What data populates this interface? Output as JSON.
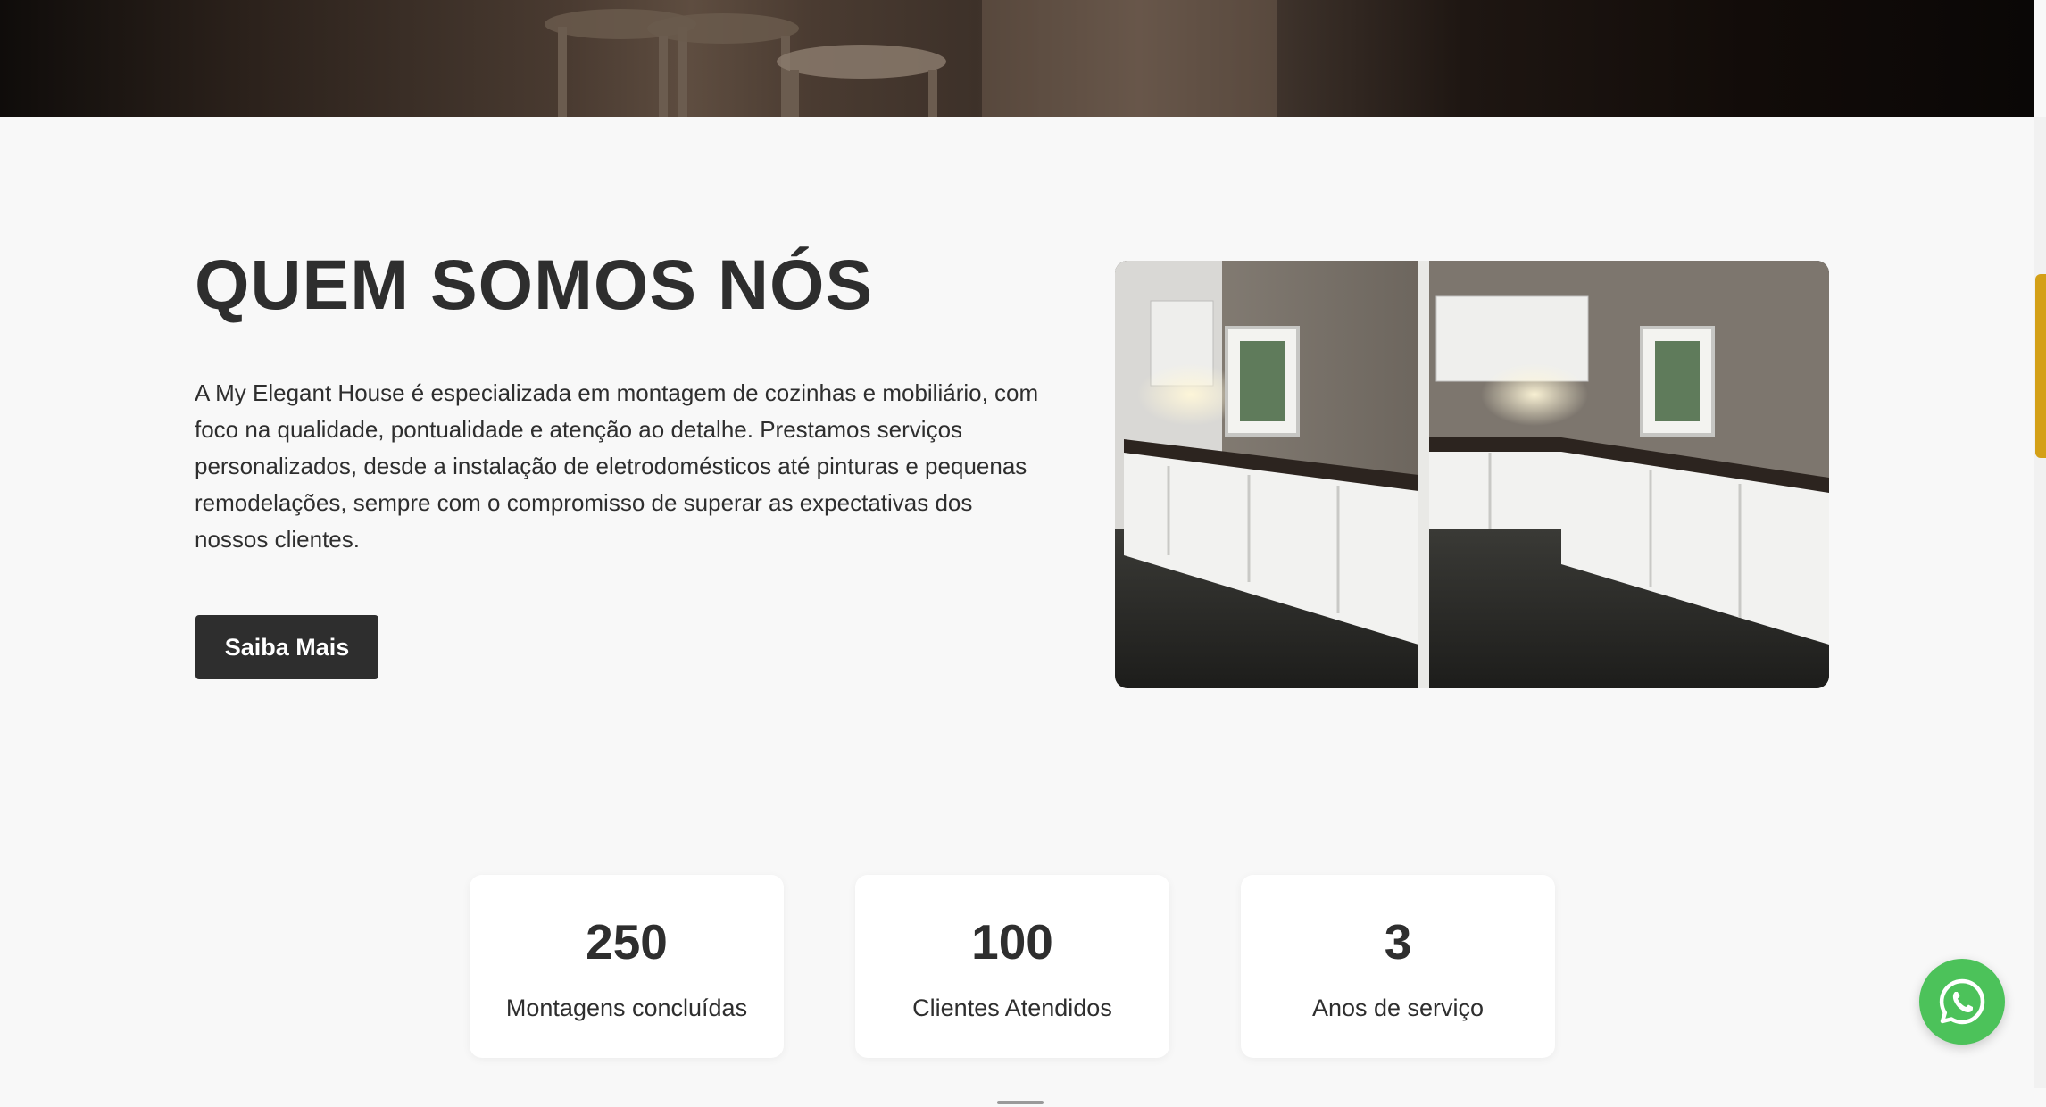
{
  "about": {
    "title": "QUEM SOMOS NÓS",
    "description": "A My Elegant House é especializada em montagem de cozinhas e mobiliário, com foco na qualidade, pontualidade e atenção ao detalhe. Prestamos serviços personalizados, desde a instalação de eletrodomésticos até pinturas e pequenas remodelações, sempre com o compromisso de superar as expectativas dos nossos clientes.",
    "button_label": "Saiba Mais"
  },
  "stats": [
    {
      "value": "250",
      "label": "Montagens concluídas"
    },
    {
      "value": "100",
      "label": "Clientes Atendidos"
    },
    {
      "value": "3",
      "label": "Anos de serviço"
    }
  ],
  "icons": {
    "chat_button": "whatsapp-icon"
  },
  "colors": {
    "heading": "#2e2e2e",
    "button_bg": "#2e2e2e",
    "whatsapp": "#4cc25a",
    "scroll_thumb": "#d4a017"
  }
}
